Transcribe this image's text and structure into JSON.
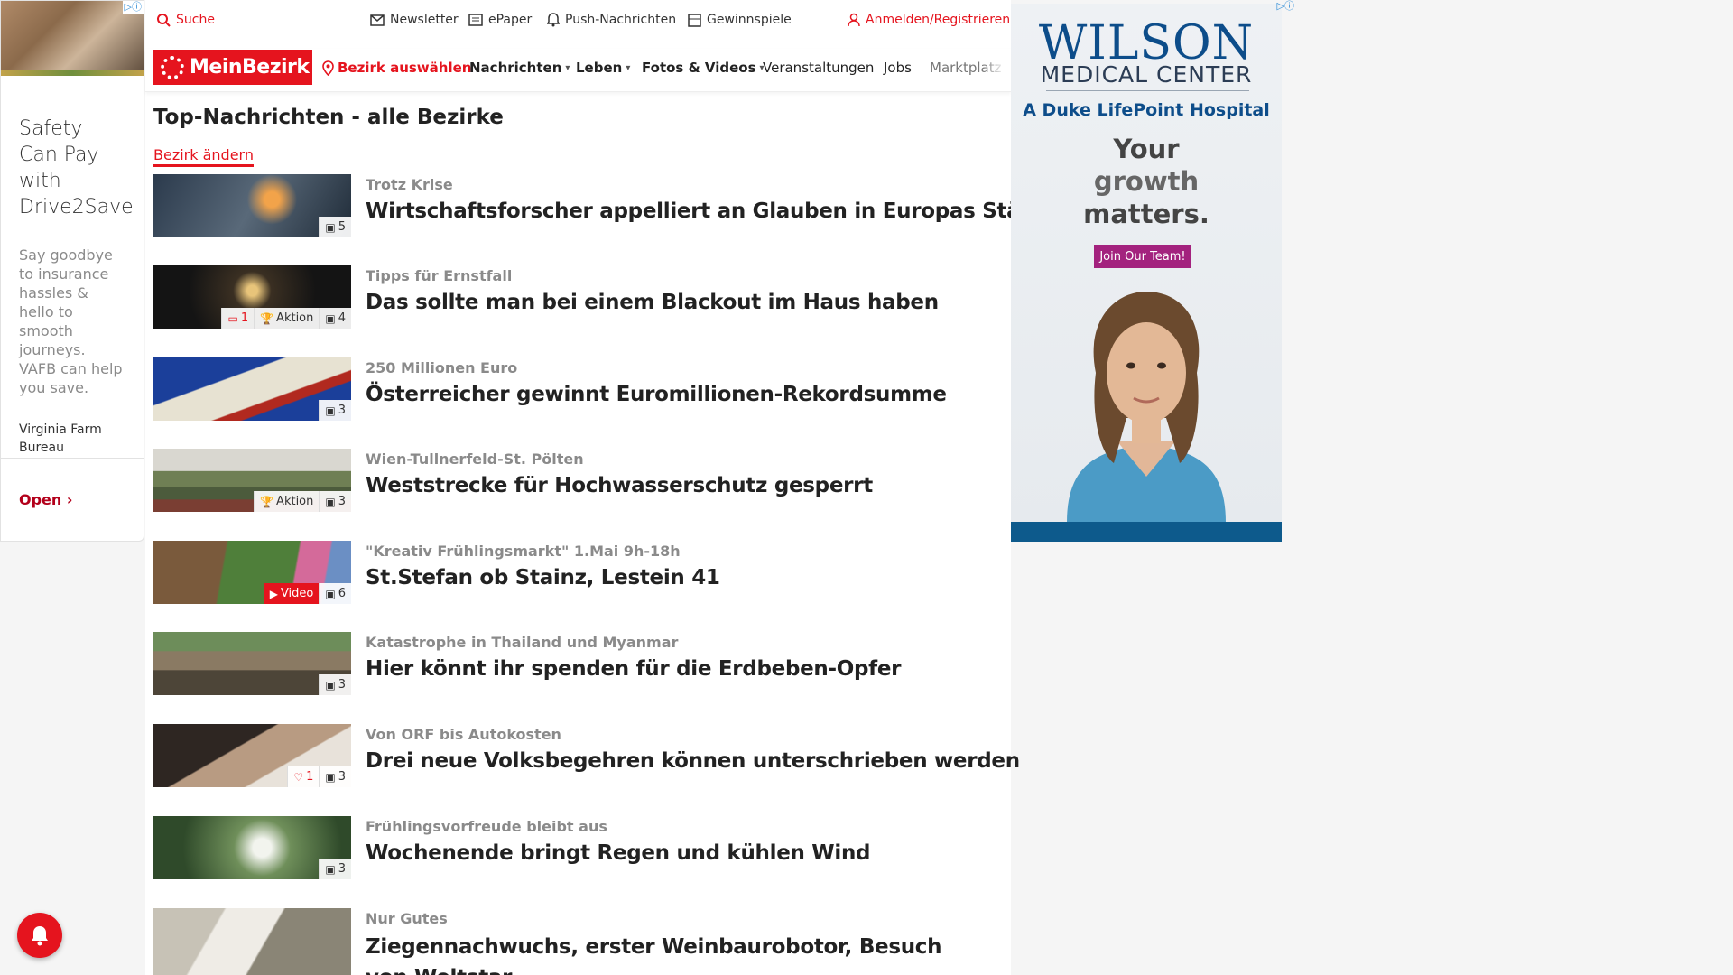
{
  "left_ad": {
    "headline": "Safety Can Pay with Drive2Save",
    "body": "Say goodbye to insurance hassles & hello to smooth journeys. VAFB can help you save.",
    "brand": "Virginia Farm Bureau",
    "cta": "Open",
    "adchoices": "▷ⓘ"
  },
  "topbar": {
    "search": "Suche",
    "newsletter": "Newsletter",
    "epaper": "ePaper",
    "push": "Push-Nachrichten",
    "gewinnspiele": "Gewinnspiele",
    "login": "Anmelden/Registrieren"
  },
  "nav": {
    "logo": "MeinBezirk",
    "bezirk": "Bezirk auswählen",
    "nachrichten": "Nachrichten",
    "leben": "Leben",
    "fotos": "Fotos & Videos",
    "veranstaltungen": "Veranstaltungen",
    "jobs": "Jobs",
    "marktplatz": "Marktplatz"
  },
  "page": {
    "title": "Top-Nachrichten - alle Bezirke",
    "change_bezirk": "Bezirk ändern"
  },
  "articles": [
    {
      "kicker": "Trotz Krise",
      "headline": "Wirtschaftsforscher appelliert an Glauben in Europas Stärke",
      "photos": "5",
      "aktion": "",
      "comments": "",
      "likes": "",
      "video": ""
    },
    {
      "kicker": "Tipps für Ernstfall",
      "headline": "Das sollte man bei einem Blackout im Haus haben",
      "photos": "4",
      "aktion": "Aktion",
      "comments": "1",
      "likes": "",
      "video": ""
    },
    {
      "kicker": "250 Millionen Euro",
      "headline": "Österreicher gewinnt Euromillionen-Rekordsumme",
      "photos": "3",
      "aktion": "",
      "comments": "",
      "likes": "",
      "video": ""
    },
    {
      "kicker": "Wien-Tullnerfeld-St. Pölten",
      "headline": "Weststrecke für Hochwasserschutz gesperrt",
      "photos": "3",
      "aktion": "Aktion",
      "comments": "",
      "likes": "",
      "video": ""
    },
    {
      "kicker": "\"Kreativ Frühlingsmarkt\" 1.Mai 9h-18h",
      "headline": "St.Stefan ob Stainz, Lestein 41",
      "photos": "6",
      "aktion": "",
      "comments": "",
      "likes": "",
      "video": "Video"
    },
    {
      "kicker": "Katastrophe in Thailand und Myanmar",
      "headline": "Hier könnt ihr spenden für die Erdbeben-Opfer",
      "photos": "3",
      "aktion": "",
      "comments": "",
      "likes": "",
      "video": ""
    },
    {
      "kicker": "Von ORF bis Autokosten",
      "headline": "Drei neue Volksbegehren können unterschrieben werden",
      "photos": "3",
      "aktion": "",
      "comments": "",
      "likes": "1",
      "video": ""
    },
    {
      "kicker": "Frühlingsvorfreude bleibt aus",
      "headline": "Wochenende bringt Regen und kühlen Wind",
      "photos": "3",
      "aktion": "",
      "comments": "",
      "likes": "",
      "video": ""
    },
    {
      "kicker": "Nur Gutes",
      "headline": "Ziegennachwuchs, erster Weinbaurobotor, Besuch von Weltstar",
      "photos": "",
      "aktion": "",
      "comments": "",
      "likes": "",
      "video": ""
    }
  ],
  "right_ad": {
    "wilson": "WILSON",
    "medical": "MEDICAL CENTER",
    "duke": "A Duke LifePoint Hospital",
    "growth_line1": "Your",
    "growth_line2": "growth",
    "growth_line3": "matters.",
    "join": "Join Our Team!",
    "adchoices": "▷ⓘ"
  },
  "colors": {
    "brand_red": "#e5141e",
    "ad_blue": "#0d4d8a",
    "ad_purple": "#a3227e"
  }
}
